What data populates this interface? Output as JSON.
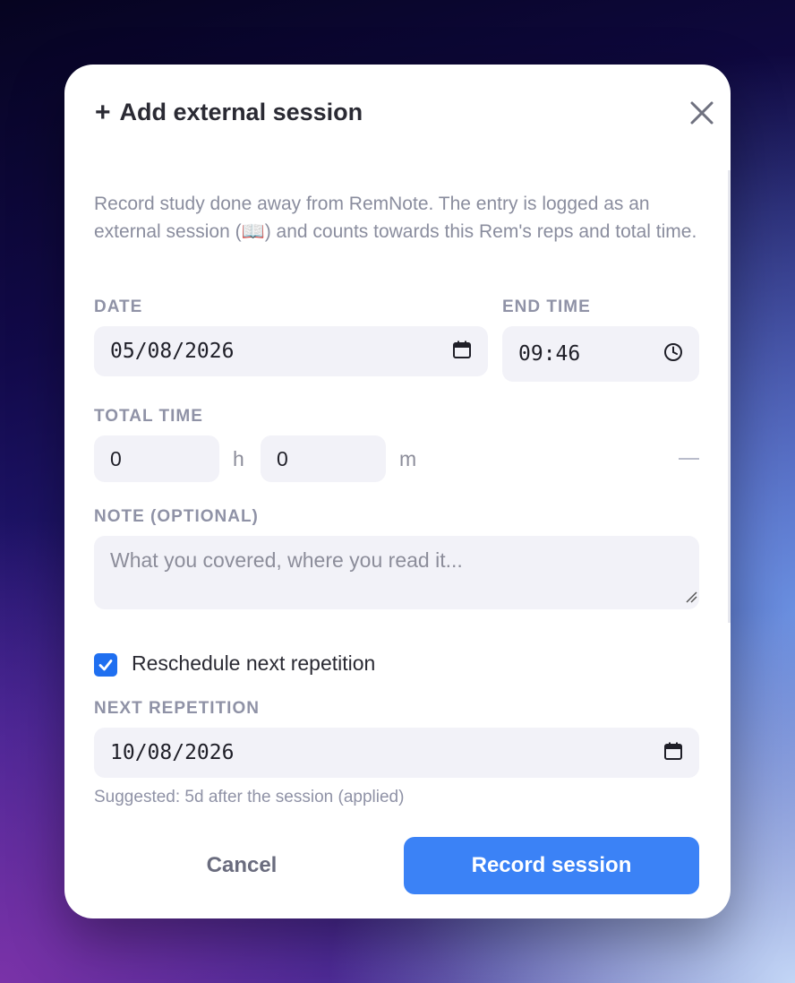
{
  "dialog": {
    "title": "Add external session",
    "description": "Record study done away from RemNote. The entry is logged as an external session (📖) and counts towards this Rem's reps and total time."
  },
  "fields": {
    "date_label": "DATE",
    "date_value": "05/08/2026",
    "end_time_label": "END TIME",
    "end_time_value": "09:46",
    "total_time_label": "TOTAL TIME",
    "hours_value": "0",
    "hours_unit": "h",
    "minutes_value": "0",
    "minutes_unit": "m",
    "total_summary": "—",
    "note_label": "NOTE (OPTIONAL)",
    "note_placeholder": "What you covered, where you read it...",
    "reschedule_label": "Reschedule next repetition",
    "reschedule_checked": true,
    "next_rep_label": "NEXT REPETITION",
    "next_rep_value": "10/08/2026",
    "suggestion": "Suggested: 5d after the session (applied)"
  },
  "actions": {
    "cancel_label": "Cancel",
    "record_label": "Record session"
  },
  "icons": {
    "add": "plus-icon",
    "close": "close-icon",
    "calendar": "calendar-icon",
    "clock": "clock-icon",
    "check": "check-icon"
  },
  "colors": {
    "primary": "#3b82f6",
    "checkbox": "#1f6ff0",
    "field_bg": "#f2f2f8",
    "label": "#8f92a6"
  }
}
